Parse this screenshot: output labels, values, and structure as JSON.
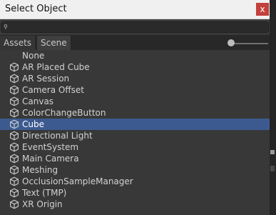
{
  "window": {
    "title": "Select Object",
    "close_glyph": "x"
  },
  "search": {
    "value": "",
    "placeholder": "",
    "icon": "search-icon"
  },
  "tabs": [
    {
      "label": "Assets"
    },
    {
      "label": "Scene"
    }
  ],
  "items": [
    {
      "label": "None",
      "icon": null,
      "selected": false
    },
    {
      "label": "AR Placed Cube",
      "icon": "gameobject-cube-icon",
      "selected": false
    },
    {
      "label": "AR Session",
      "icon": "gameobject-cube-icon",
      "selected": false
    },
    {
      "label": "Camera Offset",
      "icon": "gameobject-cube-icon",
      "selected": false
    },
    {
      "label": "Canvas",
      "icon": "gameobject-cube-icon",
      "selected": false
    },
    {
      "label": "ColorChangeButton",
      "icon": "gameobject-cube-icon",
      "selected": false
    },
    {
      "label": "Cube",
      "icon": "gameobject-cube-icon",
      "selected": true
    },
    {
      "label": "Directional Light",
      "icon": "gameobject-cube-icon",
      "selected": false
    },
    {
      "label": "EventSystem",
      "icon": "gameobject-cube-icon",
      "selected": false
    },
    {
      "label": "Main Camera",
      "icon": "gameobject-cube-icon",
      "selected": false
    },
    {
      "label": "Meshing",
      "icon": "gameobject-cube-icon",
      "selected": false
    },
    {
      "label": "OcclusionSampleManager",
      "icon": "gameobject-cube-icon",
      "selected": false
    },
    {
      "label": "Text (TMP)",
      "icon": "gameobject-cube-icon",
      "selected": false
    },
    {
      "label": "XR Origin",
      "icon": "gameobject-cube-icon",
      "selected": false
    }
  ],
  "colors": {
    "selection": "#3c5a8f",
    "close_button": "#c3403b",
    "background": "#383838"
  }
}
